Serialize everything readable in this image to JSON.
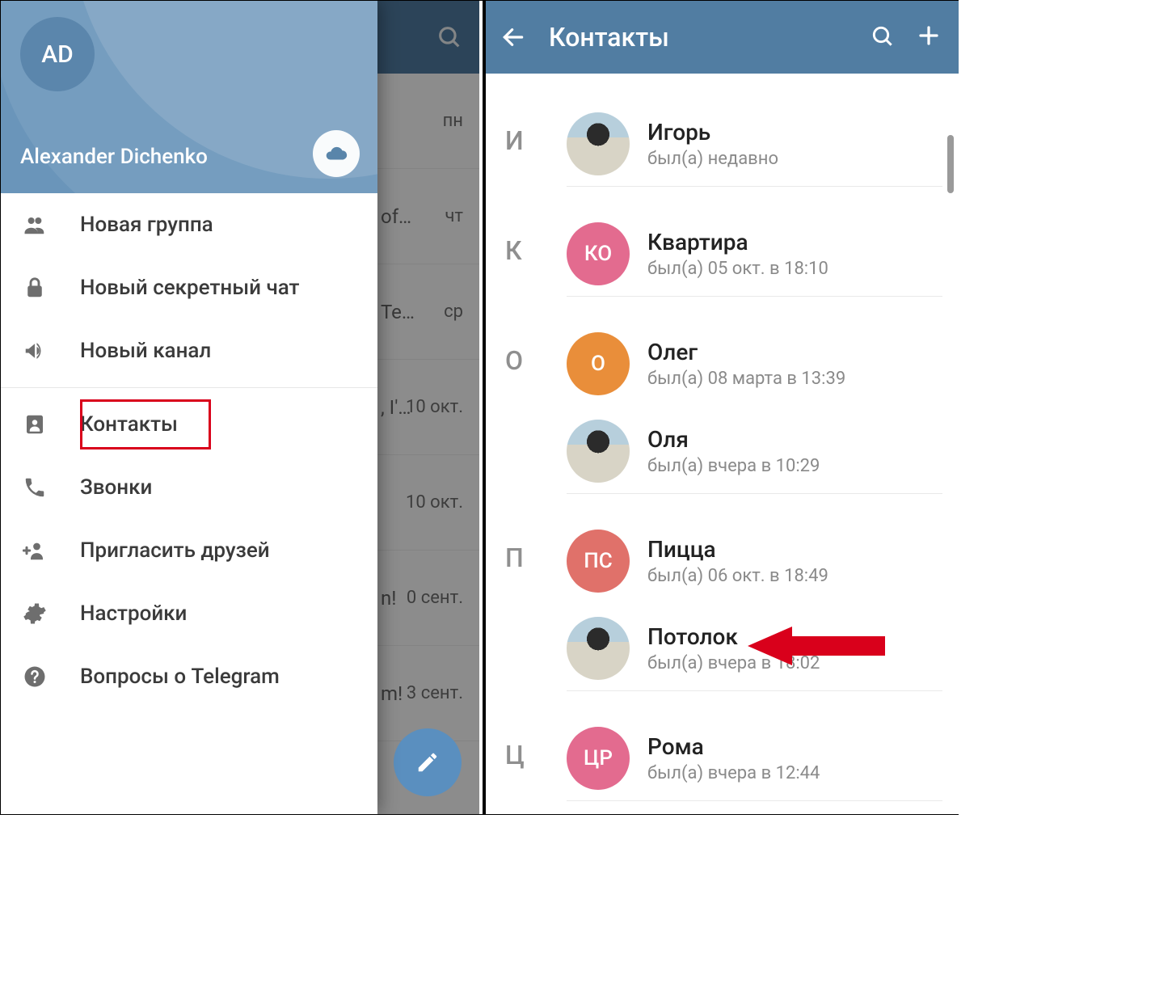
{
  "left": {
    "avatar_initials": "AD",
    "user_name": "Alexander Dichenko",
    "menu": [
      {
        "icon": "group",
        "label": "Новая группа"
      },
      {
        "icon": "lock",
        "label": "Новый секретный чат"
      },
      {
        "icon": "channel",
        "label": "Новый канал"
      }
    ],
    "menu2": [
      {
        "icon": "contacts",
        "label": "Контакты",
        "highlight": true
      },
      {
        "icon": "phone",
        "label": "Звонки"
      },
      {
        "icon": "invite",
        "label": "Пригласить друзей"
      },
      {
        "icon": "settings",
        "label": "Настройки"
      },
      {
        "icon": "help",
        "label": "Вопросы о Telegram"
      }
    ],
    "chat_rows": [
      {
        "date": "пн",
        "snippet": ""
      },
      {
        "date": "чт",
        "snippet": "of…"
      },
      {
        "date": "ср",
        "snippet": "Te…"
      },
      {
        "date": "10 окт.",
        "snippet": ", I'…"
      },
      {
        "date": "10 окт.",
        "snippet": ""
      },
      {
        "date": "0 сент.",
        "snippet": "n!"
      },
      {
        "date": "3 сент.",
        "snippet": "m!"
      }
    ]
  },
  "right": {
    "title": "Контакты",
    "sections": [
      {
        "letter": "И",
        "contacts": [
          {
            "avatar": "photo",
            "initials": "",
            "name": "Игорь",
            "status": "был(а) недавно"
          }
        ]
      },
      {
        "letter": "К",
        "contacts": [
          {
            "avatar": "pink",
            "initials": "КО",
            "name": "Квартира",
            "status": "был(а) 05 окт. в 18:10"
          }
        ]
      },
      {
        "letter": "О",
        "contacts": [
          {
            "avatar": "orange",
            "initials": "О",
            "name": "Олег",
            "status": "был(а) 08 марта в 13:39"
          },
          {
            "avatar": "photo",
            "initials": "",
            "name": "Оля",
            "status": "был(а) вчера в 10:29"
          }
        ]
      },
      {
        "letter": "П",
        "contacts": [
          {
            "avatar": "coral",
            "initials": "ПС",
            "name": "Пицца",
            "status": "был(а) 06 окт. в 18:49"
          },
          {
            "avatar": "photo",
            "initials": "",
            "name": "Потолок",
            "status": "был(а) вчера в 18:02"
          }
        ]
      },
      {
        "letter": "Ц",
        "contacts": [
          {
            "avatar": "pink",
            "initials": "ЦР",
            "name": "Рома",
            "status": "был(а) вчера в 12:44"
          }
        ]
      }
    ]
  }
}
